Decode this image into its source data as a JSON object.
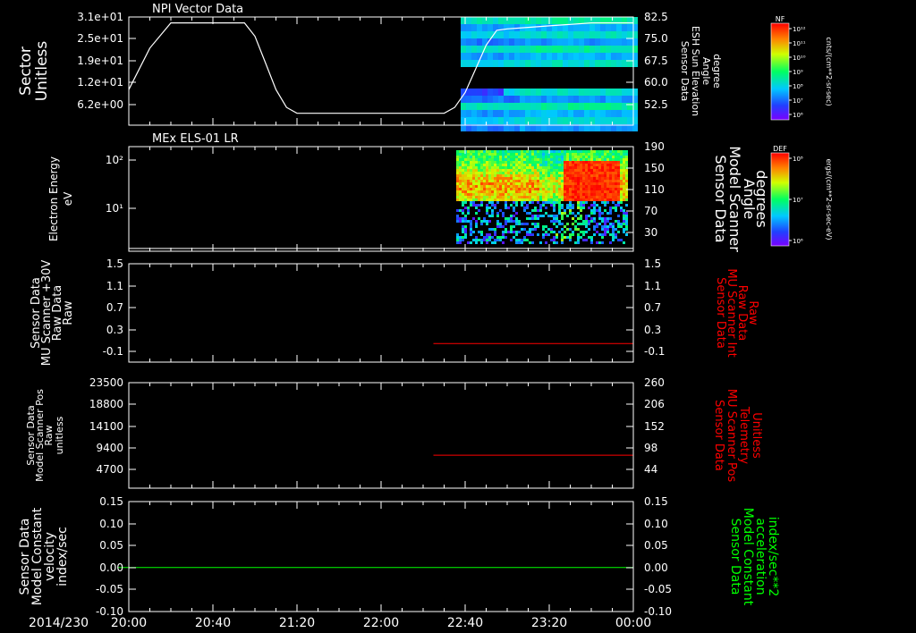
{
  "chart_data": {
    "type": "stacked-timeseries",
    "date_label": "2014/230",
    "time_ticks": [
      "20:00",
      "20:40",
      "21:20",
      "22:00",
      "22:40",
      "23:20",
      "00:00"
    ],
    "panels": [
      {
        "id": "npi",
        "type": "heatmap+line",
        "title": "NPI Vector Data",
        "left_ylabel": [
          "Sector",
          "Unitless"
        ],
        "left_ticks": [
          "3.1e+01",
          "2.5e+01",
          "1.9e+01",
          "1.2e+01",
          "6.2e+00"
        ],
        "right_ylabel": [
          "Sensor Data",
          "ESH Sun Elevation",
          "Angle",
          "degree"
        ],
        "right_ticks": [
          "82.5",
          "75.0",
          "67.5",
          "60.0",
          "52.5"
        ],
        "right_ylim": [
          46,
          82.5
        ],
        "line_series": {
          "color": "#ffffff",
          "x_minutes": [
            0,
            10,
            20,
            30,
            40,
            50,
            55,
            60,
            65,
            70,
            75,
            80,
            85,
            90,
            100,
            110,
            120,
            130,
            140,
            150,
            155,
            160,
            165,
            170,
            175,
            180,
            190,
            200,
            210,
            220,
            230,
            240
          ],
          "values": [
            58,
            72,
            80.5,
            80.5,
            80.5,
            80.5,
            80.5,
            76,
            67,
            58,
            52,
            50,
            50,
            50,
            50,
            50,
            50,
            50,
            50,
            50,
            52,
            57,
            65,
            73,
            78,
            78.5,
            79,
            79.5,
            80,
            80.5,
            80.5,
            80.5
          ]
        },
        "colorbar": {
          "label": "NF",
          "unit": "cnts/(cm**2-sr-sec)",
          "ticks": [
            "10¹²",
            "10¹¹",
            "10¹⁰",
            "10⁹",
            "10⁸",
            "10⁷",
            "10⁶"
          ]
        }
      },
      {
        "id": "els",
        "type": "heatmap+line",
        "title": "MEx ELS-01 LR",
        "left_ylabel": [
          "Electron Energy",
          "eV"
        ],
        "left_ticks": [
          "10²",
          "10¹"
        ],
        "right_ylabel": [
          "Sensor Data",
          "Model Scanner",
          "Angle",
          "degrees"
        ],
        "right_ticks": [
          "190",
          "150",
          "110",
          "70",
          "30"
        ],
        "right_ylim": [
          0,
          190
        ],
        "line_series": {
          "color": "#ffffff",
          "constant": 5
        },
        "colorbar": {
          "label": "DEF",
          "unit": "ergs/(cm**2-sr-sec-eV)",
          "ticks": [
            "10⁸",
            "10⁷",
            "10⁶"
          ]
        }
      },
      {
        "id": "mu_raw",
        "type": "line",
        "left_ylabel": [
          "Sensor Data",
          "MU Scanner +30V",
          "Raw Data",
          "Raw"
        ],
        "left_ticks": [
          "1.5",
          "1.1",
          "0.7",
          "0.3",
          "-0.1"
        ],
        "right_ylabel": [
          "Sensor Data",
          "MU Scanner Int",
          "Raw Data",
          "Raw"
        ],
        "right_ticks": [
          "1.5",
          "1.1",
          "0.7",
          "0.3",
          "-0.1"
        ],
        "right_ylim": [
          -0.35,
          1.5
        ],
        "series": [
          {
            "color": "#ff0000",
            "start_min": 150,
            "end_min": 240,
            "value": 0.0
          }
        ]
      },
      {
        "id": "scan_pos",
        "type": "line",
        "left_ylabel": [
          "Sensor Data",
          "Model Scanner Pos",
          "Raw",
          "unitless"
        ],
        "left_ticks": [
          "23500",
          "18800",
          "14100",
          "9400",
          "4700"
        ],
        "right_ylabel": [
          "Sensor Data",
          "MU Scanner Pos",
          "Telemetry",
          "Unitless"
        ],
        "right_ticks": [
          "260",
          "206",
          "152",
          "98",
          "44"
        ],
        "right_ylim": [
          -2,
          260
        ],
        "series": [
          {
            "color": "#ff0000",
            "start_min": 150,
            "end_min": 240,
            "value": 80
          }
        ]
      },
      {
        "id": "velocity",
        "type": "line",
        "left_ylabel": [
          "Sensor Data",
          "Model Constant",
          "velocity",
          "index/sec"
        ],
        "left_ticks": [
          "0.15",
          "0.10",
          "0.05",
          "0.00",
          "-0.05",
          "-0.10"
        ],
        "right_ylabel": [
          "Sensor Data",
          "Model Constant",
          "acceleration",
          "index/sec**2"
        ],
        "right_ticks": [
          "0.15",
          "0.10",
          "0.05",
          "0.00",
          "-0.05",
          "-0.10"
        ],
        "right_ylim": [
          -0.1,
          0.15
        ],
        "series": [
          {
            "color": "#00ff00",
            "start_min": 0,
            "end_min": 240,
            "value": 0.0
          }
        ]
      }
    ]
  },
  "colors": {
    "axis": "#ffffff",
    "red_label": "#ff0000",
    "green_label": "#00ff00",
    "background": "#000000"
  }
}
